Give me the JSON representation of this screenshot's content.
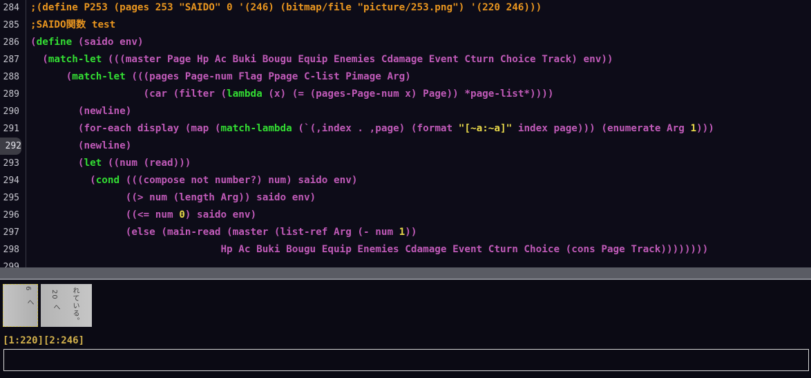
{
  "editor": {
    "active_line": "292",
    "lines": [
      {
        "num": "284",
        "tokens": [
          {
            "t": ";(define P253 (pages 253 \"SAIDO\" 0 '(246) (bitmap/file \"picture/253.png\") '(220 246)))",
            "c": "#e8951f"
          }
        ]
      },
      {
        "num": "285",
        "tokens": [
          {
            "t": ";SAIDO関数 test",
            "c": "#e8951f"
          }
        ]
      },
      {
        "num": "286",
        "tokens": [
          {
            "t": "(",
            "c": "#c05ab8"
          },
          {
            "t": "define",
            "c": "#33dd33"
          },
          {
            "t": " (saido env)",
            "c": "#c05ab8"
          }
        ]
      },
      {
        "num": "287",
        "tokens": [
          {
            "t": "  (",
            "c": "#c05ab8"
          },
          {
            "t": "match-let",
            "c": "#33dd33"
          },
          {
            "t": " (((master Page Hp Ac Buki Bougu Equip Enemies Cdamage Event Cturn Choice Track) env))",
            "c": "#c05ab8"
          }
        ]
      },
      {
        "num": "288",
        "tokens": [
          {
            "t": "      (",
            "c": "#c05ab8"
          },
          {
            "t": "match-let",
            "c": "#33dd33"
          },
          {
            "t": " (((pages Page-num Flag Ppage C-list Pimage Arg)",
            "c": "#c05ab8"
          }
        ]
      },
      {
        "num": "289",
        "tokens": [
          {
            "t": "                   (car (filter (",
            "c": "#c05ab8"
          },
          {
            "t": "lambda",
            "c": "#33dd33"
          },
          {
            "t": " (x) (= (pages-Page-num x) Page)) *page-list*))))",
            "c": "#c05ab8"
          }
        ]
      },
      {
        "num": "290",
        "tokens": [
          {
            "t": "        (newline)",
            "c": "#c05ab8"
          }
        ]
      },
      {
        "num": "291",
        "tokens": [
          {
            "t": "        (for-each display (map (",
            "c": "#c05ab8"
          },
          {
            "t": "match-lambda",
            "c": "#33dd33"
          },
          {
            "t": " (`(,index . ,page) (format ",
            "c": "#c05ab8"
          },
          {
            "t": "\"[~a:~a]\"",
            "c": "#e8d84a"
          },
          {
            "t": " index page))) (enumerate Arg ",
            "c": "#c05ab8"
          },
          {
            "t": "1",
            "c": "#e8d84a"
          },
          {
            "t": ")))",
            "c": "#c05ab8"
          }
        ]
      },
      {
        "num": "292",
        "tokens": [
          {
            "t": "        (newline)",
            "c": "#c05ab8"
          }
        ]
      },
      {
        "num": "293",
        "tokens": [
          {
            "t": "        (",
            "c": "#c05ab8"
          },
          {
            "t": "let",
            "c": "#33dd33"
          },
          {
            "t": " ((num (read)))",
            "c": "#c05ab8"
          }
        ]
      },
      {
        "num": "294",
        "tokens": [
          {
            "t": "          (",
            "c": "#c05ab8"
          },
          {
            "t": "cond",
            "c": "#33dd33"
          },
          {
            "t": " (((compose not number?) num) saido env)",
            "c": "#c05ab8"
          }
        ]
      },
      {
        "num": "295",
        "tokens": [
          {
            "t": "                ((> num (length Arg)) saido env)",
            "c": "#c05ab8"
          }
        ]
      },
      {
        "num": "296",
        "tokens": [
          {
            "t": "                ((<= num ",
            "c": "#c05ab8"
          },
          {
            "t": "0",
            "c": "#e8d84a"
          },
          {
            "t": ") saido env)",
            "c": "#c05ab8"
          }
        ]
      },
      {
        "num": "297",
        "tokens": [
          {
            "t": "                (else (main-read (master (list-ref Arg (- num ",
            "c": "#c05ab8"
          },
          {
            "t": "1",
            "c": "#e8d84a"
          },
          {
            "t": "))",
            "c": "#c05ab8"
          }
        ]
      },
      {
        "num": "298",
        "tokens": [
          {
            "t": "                                Hp Ac Buki Bougu Equip Enemies Cdamage Event Cturn Choice (cons Page Track))))))))",
            "c": "#c05ab8"
          }
        ]
      },
      {
        "num": "299",
        "tokens": []
      }
    ]
  },
  "thumbnails": [
    {
      "text_a": "6",
      "text_b": "へ"
    },
    {
      "text_a": "20",
      "text_b": "へ",
      "text_c": "れている。"
    }
  ],
  "status_text": "[1:220][2:246]",
  "minibuffer_value": ""
}
